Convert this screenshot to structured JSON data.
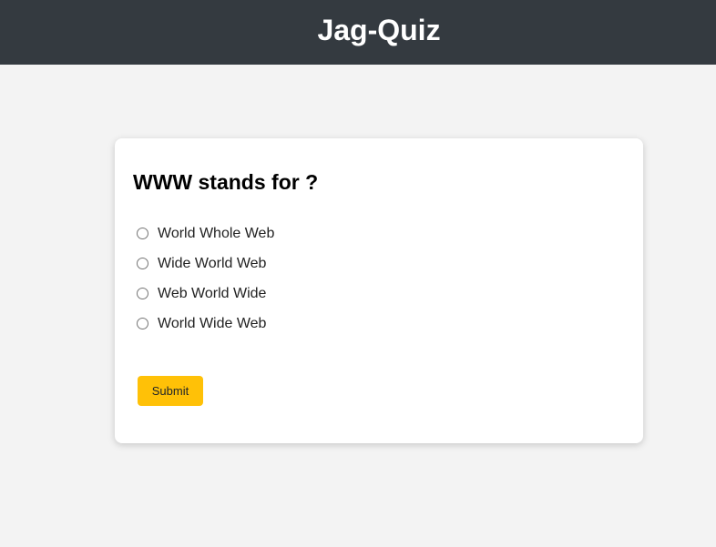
{
  "header": {
    "title": "Jag-Quiz"
  },
  "quiz": {
    "question": "WWW stands for ?",
    "options": [
      {
        "label": "World Whole Web",
        "selected": false
      },
      {
        "label": "Wide World Web",
        "selected": false
      },
      {
        "label": "Web World Wide",
        "selected": false
      },
      {
        "label": "World Wide Web",
        "selected": false
      }
    ],
    "submit_label": "Submit"
  },
  "colors": {
    "header_bg": "#343a40",
    "page_bg": "#f3f3f3",
    "card_bg": "#ffffff",
    "accent": "#ffc107"
  }
}
